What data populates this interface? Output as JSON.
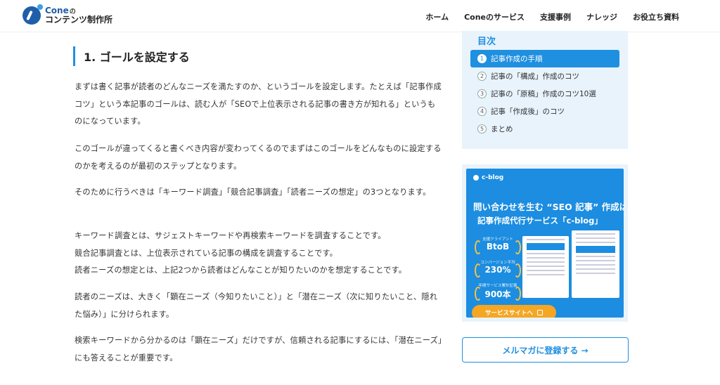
{
  "header": {
    "logo_line1": "Cone",
    "logo_line1_small": "の",
    "logo_line2": "コンテンツ制作所",
    "nav": [
      "ホーム",
      "Coneのサービス",
      "支援事例",
      "ナレッジ",
      "お役立ち資料"
    ]
  },
  "article": {
    "heading": "1. ゴールを設定する",
    "paragraphs": [
      "まずは書く記事が読者のどんなニーズを満たすのか、というゴールを設定します。たとえば「記事作成 コツ」という本記事のゴールは、読む人が「SEOで上位表示される記事の書き方が知れる」というものになっています。",
      "このゴールが違ってくると書くべき内容が変わってくるのでまずはこのゴールをどんなものに設定するのかを考えるのが最初のステップとなります。",
      "そのために行うべきは「キーワード調査」「競合記事調査」「読者ニーズの想定」の3つとなります。",
      "キーワード調査とは、サジェストキーワードや再検索キーワードを調査することです。",
      "競合記事調査とは、上位表示されている記事の構成を調査することです。",
      "読者ニーズの想定とは、上記2つから読者はどんなことが知りたいのかを想定することです。",
      "読者のニーズは、大きく「顕在ニーズ（今知りたいこと）」と「潜在ニーズ（次に知りたいこと、隠れた悩み）」に分けられます。",
      "検索キーワードから分かるのは「顕在ニーズ」だけですが、信頼される記事にするには、「潜在ニーズ」にも答えることが重要です。"
    ]
  },
  "toc": {
    "title": "目次",
    "items": [
      {
        "num": "1",
        "label": "記事作成の手順"
      },
      {
        "num": "2",
        "label": "記事の「構成」作成のコツ"
      },
      {
        "num": "3",
        "label": "記事の「原稿」作成のコツ10選"
      },
      {
        "num": "4",
        "label": "記事「作成後」のコツ"
      },
      {
        "num": "5",
        "label": "まとめ"
      }
    ]
  },
  "banner": {
    "brand": "c-blog",
    "title1": "問い合わせを生む “SEO 記事” 作成は",
    "title2": "記事作成代行サービス「c-blog」",
    "stats": [
      {
        "label": "支援クライアント",
        "value": "BtoB"
      },
      {
        "label": "コンバージョン平均",
        "value": "230%"
      },
      {
        "label": "年間サービス累計記事",
        "value": "900本"
      }
    ],
    "cta": "サービスサイトへ"
  },
  "mail_button": "メルマガに登録する →",
  "colors": {
    "accent": "#1f8fe0",
    "toc_bg": "#e8f3fc",
    "cta_orange": "#f5a623"
  }
}
